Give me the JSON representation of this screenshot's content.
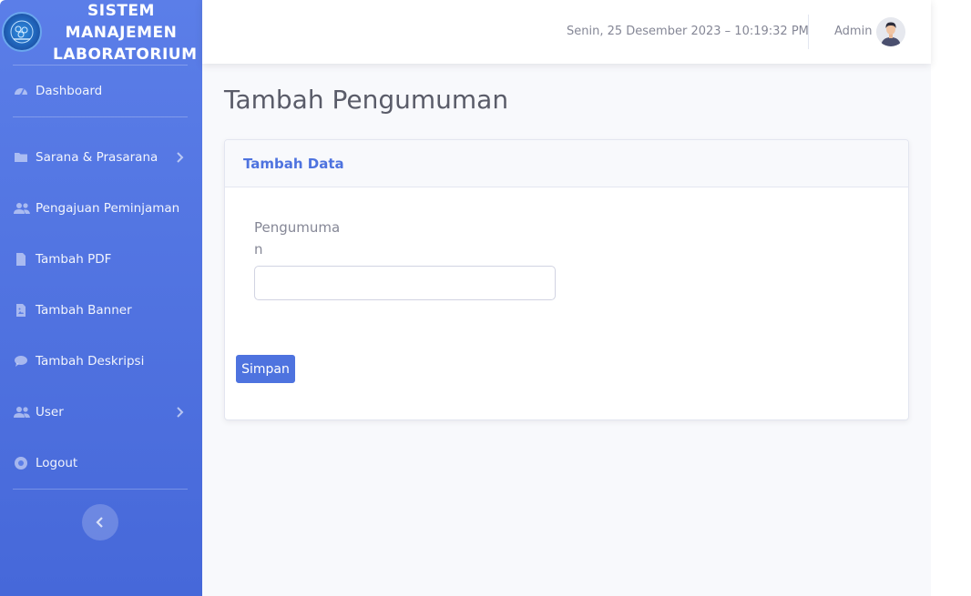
{
  "brand": {
    "title_line1": "SISTEM",
    "title_line2": "MANAJEMEN",
    "title_line3": "LABORATORIUM",
    "logo_icon": "university-logo-icon"
  },
  "sidebar": {
    "items": [
      {
        "label": "Dashboard",
        "icon": "tachometer-icon"
      },
      {
        "label": "Sarana & Prasarana",
        "icon": "folder-icon",
        "has_submenu": true
      },
      {
        "label": "Pengajuan Peminjaman",
        "icon": "users-icon"
      },
      {
        "label": "Tambah PDF",
        "icon": "file-icon"
      },
      {
        "label": "Tambah Banner",
        "icon": "file-image-icon"
      },
      {
        "label": "Tambah Deskripsi",
        "icon": "comment-icon"
      },
      {
        "label": "User",
        "icon": "users-icon",
        "has_submenu": true
      },
      {
        "label": "Logout",
        "icon": "power-icon"
      }
    ],
    "toggle_icon": "chevron-left-icon"
  },
  "topbar": {
    "datetime": "Senin, 25 Desember 2023  –  10:19:32 PM",
    "user_name": "Admin",
    "avatar_icon": "user-avatar-icon"
  },
  "main": {
    "page_title": "Tambah Pengumuman",
    "card": {
      "title": "Tambah Data",
      "field_label": "Pengumuman",
      "field_value": "",
      "field_placeholder": "",
      "submit_label": "Simpan"
    }
  },
  "colors": {
    "sidebar_gradient_top": "#5b7ee8",
    "sidebar_gradient_bottom": "#4668d9",
    "primary": "#4e73df",
    "page_background": "#f8f9fc"
  }
}
